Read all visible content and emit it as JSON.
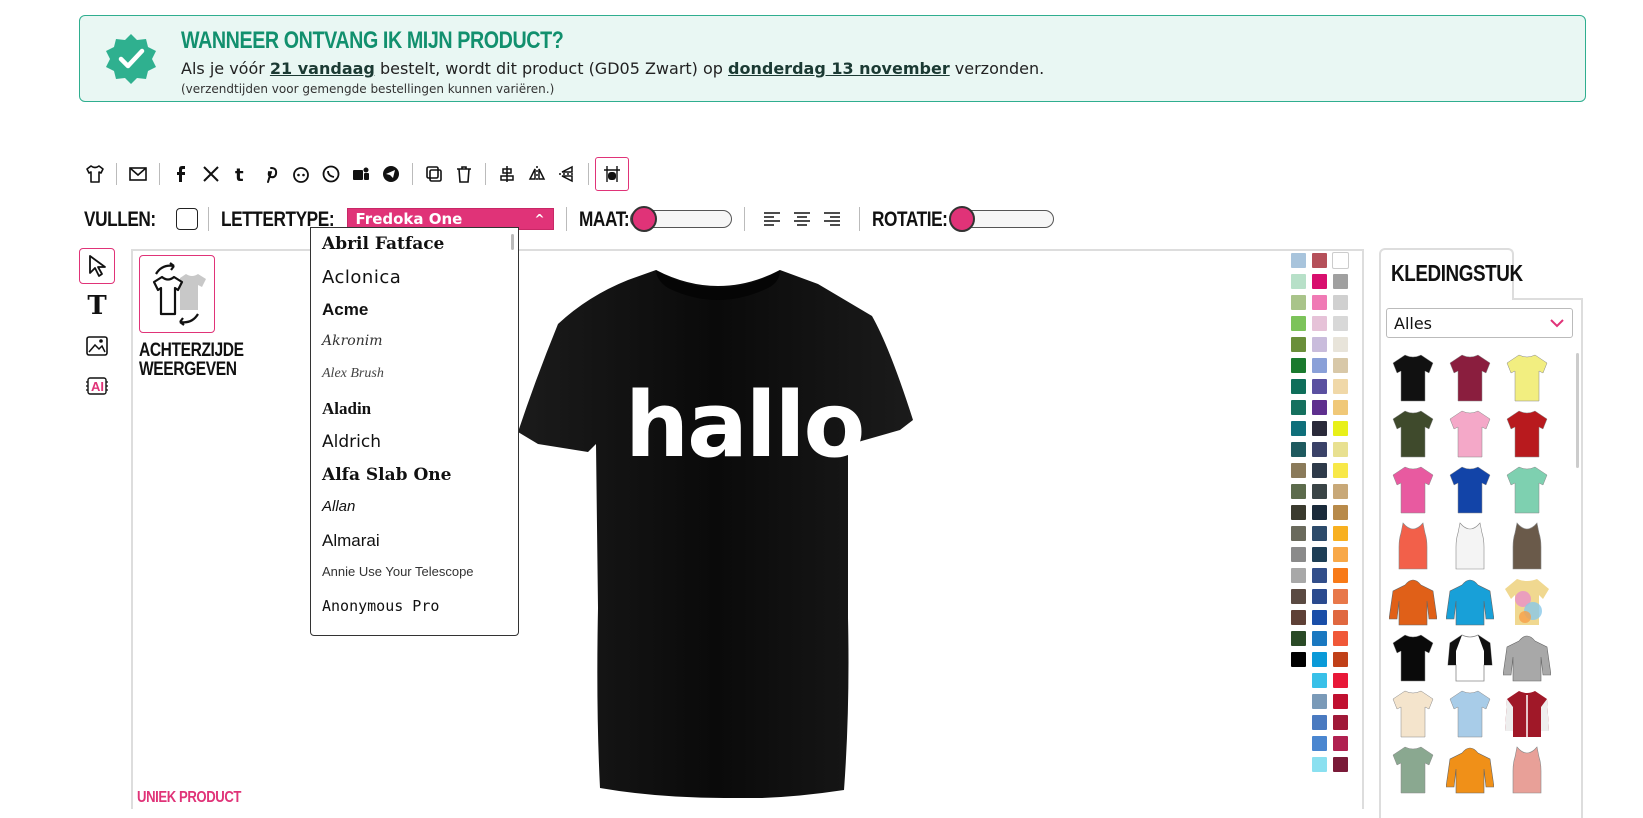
{
  "notice": {
    "title": "WANNEER ONTVANG IK MIJN PRODUCT?",
    "text_before": "Als je vóór ",
    "deadline": "21 vandaag",
    "text_middle": " bestelt, wordt dit product (GD05 Zwart) op ",
    "ship_date": "donderdag 13 november",
    "text_after": " verzonden.",
    "footnote": "(verzendtijden voor gemengde bestellingen kunnen variëren.)"
  },
  "toolbar": {
    "icons": [
      "tshirt-icon",
      "mail-icon",
      "facebook-icon",
      "x-icon",
      "tumblr-icon",
      "pinterest-icon",
      "reddit-icon",
      "whatsapp-icon",
      "teams-icon",
      "telegram-icon",
      "copy-icon",
      "trash-icon",
      "align-center-icon",
      "flip-horizontal-icon",
      "flip-vertical-icon",
      "grid-icon"
    ]
  },
  "options": {
    "fill_label": "VULLEN:",
    "font_label": "LETTERTYPE:",
    "font_selected": "Fredoka One",
    "size_label": "MAAT:",
    "rotation_label": "ROTATIE:",
    "size_value": 0.05,
    "rotation_value": 0.0
  },
  "font_list": [
    "Abril Fatface",
    "Aclonica",
    "Acme",
    "Akronim",
    "Alex Brush",
    "Aladin",
    "Aldrich",
    "Alfa Slab One",
    "Allan",
    "Almarai",
    "Annie Use Your Telescope",
    "Anonymous Pro"
  ],
  "canvas": {
    "back_label_1": "ACHTERZIJDE",
    "back_label_2": "WEERGEVEN",
    "shirt_text": "hallo",
    "uniq_label": "UNIEK PRODUCT"
  },
  "right_panel": {
    "tab_label": "KLEDINGSTUK",
    "category_selected": "Alles"
  },
  "colors": {
    "accent": "#e03378",
    "notice_green": "#12906e",
    "swatches_col1": [
      "#a8c4dc",
      "#b7e0c8",
      "#a9c48a",
      "#7cc35a",
      "#6a8f3a",
      "#1a7a2e",
      "#0f6e5a",
      "#15705e",
      "#0f6f7a",
      "#1f5a5f",
      "#8a7a5a",
      "#5c6b4c",
      "#3a3a2e",
      "#6a6a5c",
      "#8a8a8a",
      "#a8a8a8",
      "#5a4a42",
      "#5e4036",
      "#2a4a26",
      "#000000"
    ],
    "swatches_col2": [
      "#b5505a",
      "#d80f6e",
      "#f07ab5",
      "#e6c2d8",
      "#c9bcdc",
      "#8aa0d8",
      "#5a50a0",
      "#5e2f8e",
      "#2a2a3a",
      "#3a4268",
      "#2e3a4a",
      "#3a4446",
      "#1a2a3a",
      "#2c4a6a",
      "#1e3e56",
      "#324e8a",
      "#2a4a8e",
      "#1a4ea8",
      "#1a78c0",
      "#0a9ad8",
      "#38c0e8",
      "#7a9ab8",
      "#4a7ac0",
      "#4a86d0",
      "#8ae0f0"
    ],
    "swatches_col3": [
      "#ffffff",
      "#a0a0a0",
      "#d0d0d0",
      "#d8d8d8",
      "#e8e4da",
      "#d8c8a8",
      "#f0d8a8",
      "#f0c878",
      "#e8f01a",
      "#e8e090",
      "#f8e848",
      "#c8a878",
      "#b88a4a",
      "#f8b020",
      "#f8a848",
      "#f87a18",
      "#e8784a",
      "#e06840",
      "#f05838",
      "#c04018",
      "#e81838",
      "#c01030",
      "#a01838",
      "#b02050",
      "#7a1a38"
    ]
  }
}
